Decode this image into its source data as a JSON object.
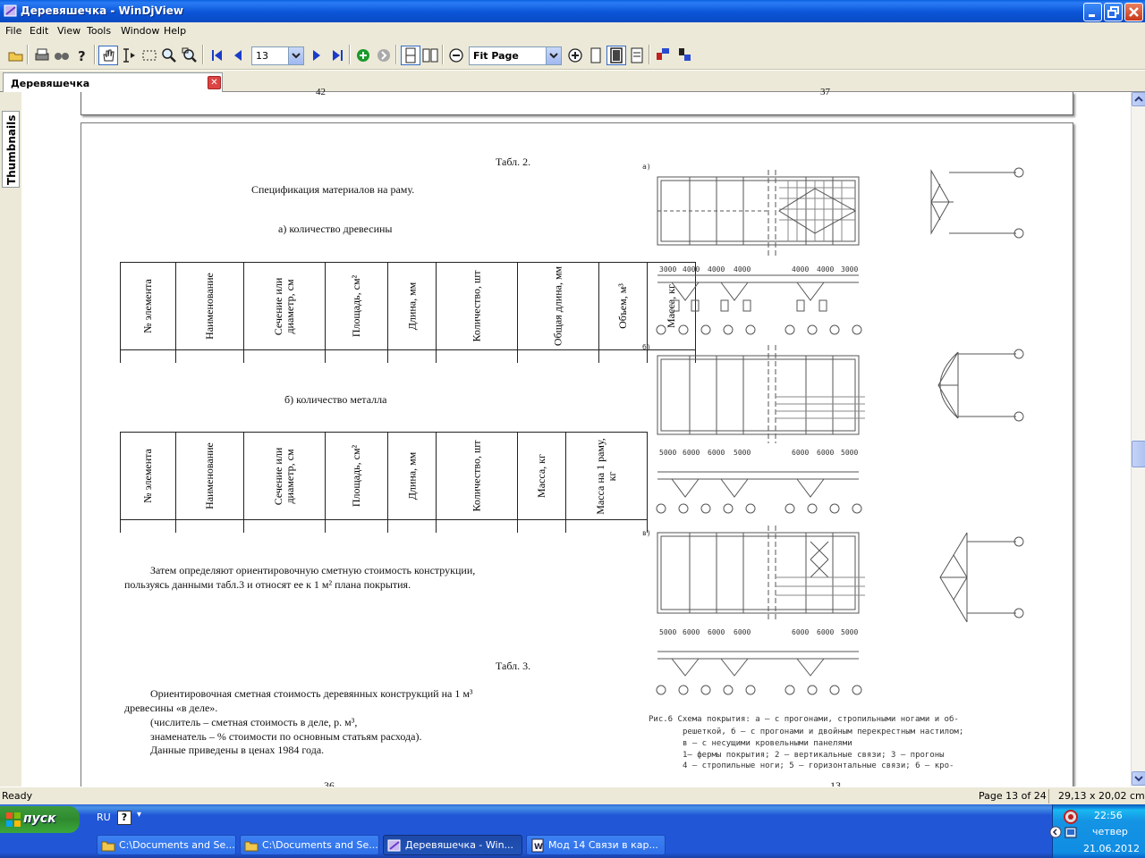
{
  "window": {
    "title": "Деревяшечка - WinDjView"
  },
  "menu": [
    "File",
    "Edit",
    "View",
    "Tools",
    "Window",
    "Help"
  ],
  "toolbar": {
    "page_number": "13",
    "zoom": "Fit Page"
  },
  "tab": {
    "label": "Деревяшечка"
  },
  "sidebar": {
    "thumbnails_label": "Thumbnails"
  },
  "page_prev": {
    "num_left": "42",
    "num_right": "37"
  },
  "page": {
    "table2_title": "Табл. 2.",
    "spec_title": "Спецификация материалов на раму.",
    "wood_title": "а) количество древесины",
    "wood_headers": [
      "№ элемента",
      "Наименование",
      "Сечение или диаметр, см",
      "Площадь, см²",
      "Длина, мм",
      "Количество, шт",
      "Общая длина, мм",
      "Объем, м³",
      "Масса, кг"
    ],
    "metal_title": "б) количество металла",
    "metal_headers": [
      "№ элемента",
      "Наименование",
      "Сечение или диаметр, см",
      "Площадь, см²",
      "Длина, мм",
      "Количество, шт",
      "Масса, кг",
      "Масса на 1 раму, кг"
    ],
    "para1_line1": "Затем определяют ориентировочную сметную стоимость конструкции,",
    "para1_line2": "пользуясь данными табл.3  и относят ее к 1 м² плана покрытия.",
    "table3_title": "Табл. 3.",
    "para2_line1": "Ориентировочная сметная стоимость деревянных конструкций на 1 м³",
    "para2_line2": "древесины «в деле».",
    "para2_line3": "(числитель – сметная стоимость в деле, р. м³,",
    "para2_line4": "знаменатель – % стоимости по основным статьям расхода).",
    "para2_line5": "Данные приведены в ценах 1984 года.",
    "page_num_left": "36",
    "page_num_right": "13",
    "fig_caption": [
      "Рис.6  Схема покрытия: а – с прогонами, стропильными ногами и об-",
      "решеткой, б – с прогонами и двойным перекрестным настилом;",
      "в – с несущими кровельными панелями",
      "1– фермы покрытия; 2 – вертикальные связи; 3 – прогоны",
      "4 – стропильные ноги; 5 – горизонтальные связи; 6 – кро-"
    ],
    "dims_a": [
      "3000",
      "4000",
      "4000",
      "4000",
      "4000",
      "4000",
      "3000"
    ],
    "dims_b": [
      "5000",
      "6000",
      "6000",
      "5000",
      "6000",
      "6000",
      "5000"
    ],
    "dims_c": [
      "5000",
      "6000",
      "6000",
      "6000",
      "6000",
      "6000",
      "5000"
    ],
    "fig_labels": {
      "a": "а)",
      "b": "б)",
      "c": "в)"
    }
  },
  "status": {
    "left": "Ready",
    "page": "Page 13 of 24",
    "size": "29,13 x 20,02 cm"
  },
  "taskbar": {
    "start": "пуск",
    "lang": "RU",
    "tasks": [
      "C:\\Documents and Se...",
      "C:\\Documents and Se...",
      "Деревяшечка - Win...",
      "Мод 14  Связи в кар..."
    ],
    "time": "22:56",
    "day": "четвер",
    "date": "21.06.2012"
  }
}
